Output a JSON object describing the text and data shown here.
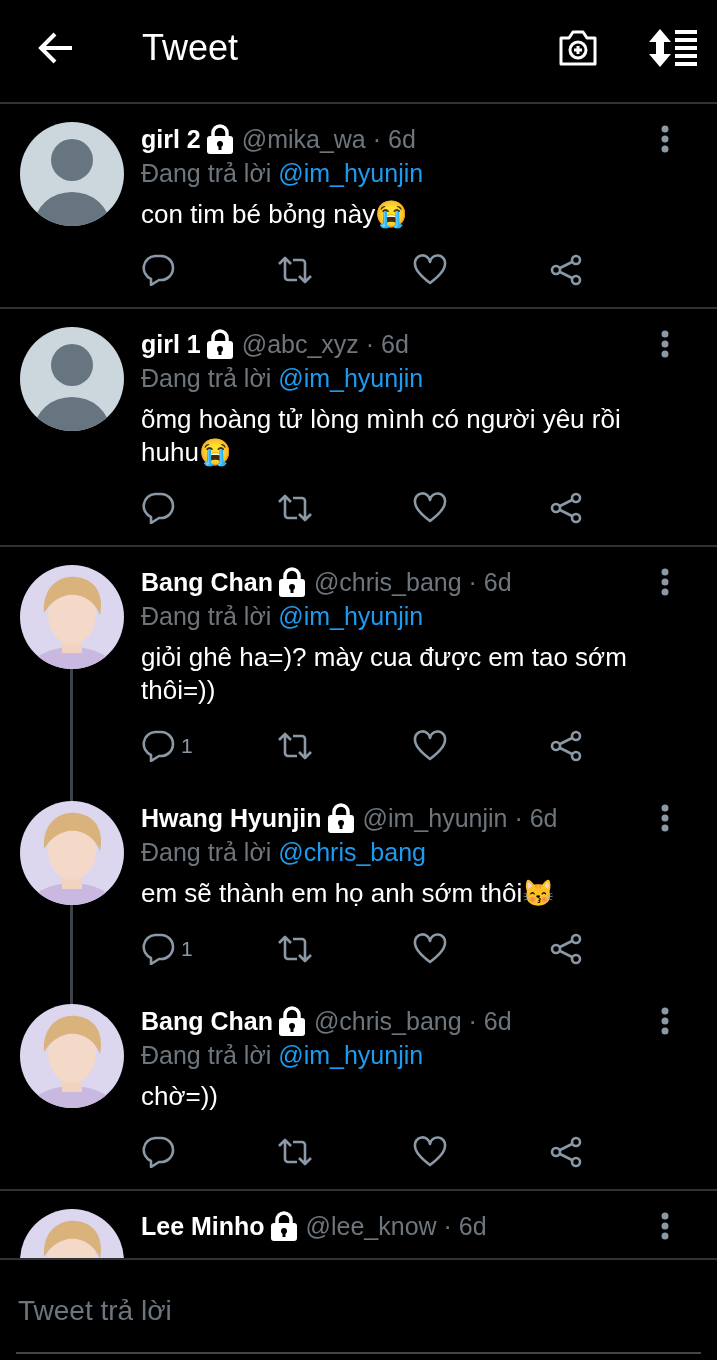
{
  "header": {
    "title": "Tweet"
  },
  "tweets": [
    {
      "avatar": {
        "kind": "default"
      },
      "name": "girl 2",
      "meta": "@mika_wa · 6d",
      "reply_label": "Đang trả lời",
      "reply_to": "@im_hyunjin",
      "text": "con tim bé bỏng này😭",
      "thread_below": false
    },
    {
      "avatar": {
        "kind": "default"
      },
      "name": "girl 1",
      "meta": "@abc_xyz · 6d",
      "reply_label": "Đang trả lời",
      "reply_to": "@im_hyunjin",
      "text": "õmg hoàng tử lòng mình có người yêu rồi huhu😭",
      "thread_below": false
    },
    {
      "name": "Bang Chan",
      "meta": "@chris_bang · 6d",
      "reply_label": "Đang trả lời",
      "reply_to": "@im_hyunjin",
      "text": "giỏi ghê ha=)? mày cua được em tao sớm thôi=))",
      "reply_count": "1",
      "thread_below": true
    },
    {
      "name": "Hwang Hyunjin",
      "meta": "@im_hyunjin · 6d",
      "reply_label": "Đang trả lời",
      "reply_to": "@chris_bang",
      "text": "em sẽ thành em họ anh sớm thôi😽",
      "reply_count": "1",
      "thread_below": true
    },
    {
      "name": "Bang Chan",
      "meta": "@chris_bang · 6d",
      "reply_label": "Đang trả lời",
      "reply_to": "@im_hyunjin",
      "text": "chờ=))",
      "thread_below": false
    },
    {
      "name": "Lee Minho",
      "meta": "@lee_know · 6d",
      "thread_below": false
    }
  ],
  "reply_bar": {
    "placeholder": "Tweet trả lời"
  }
}
